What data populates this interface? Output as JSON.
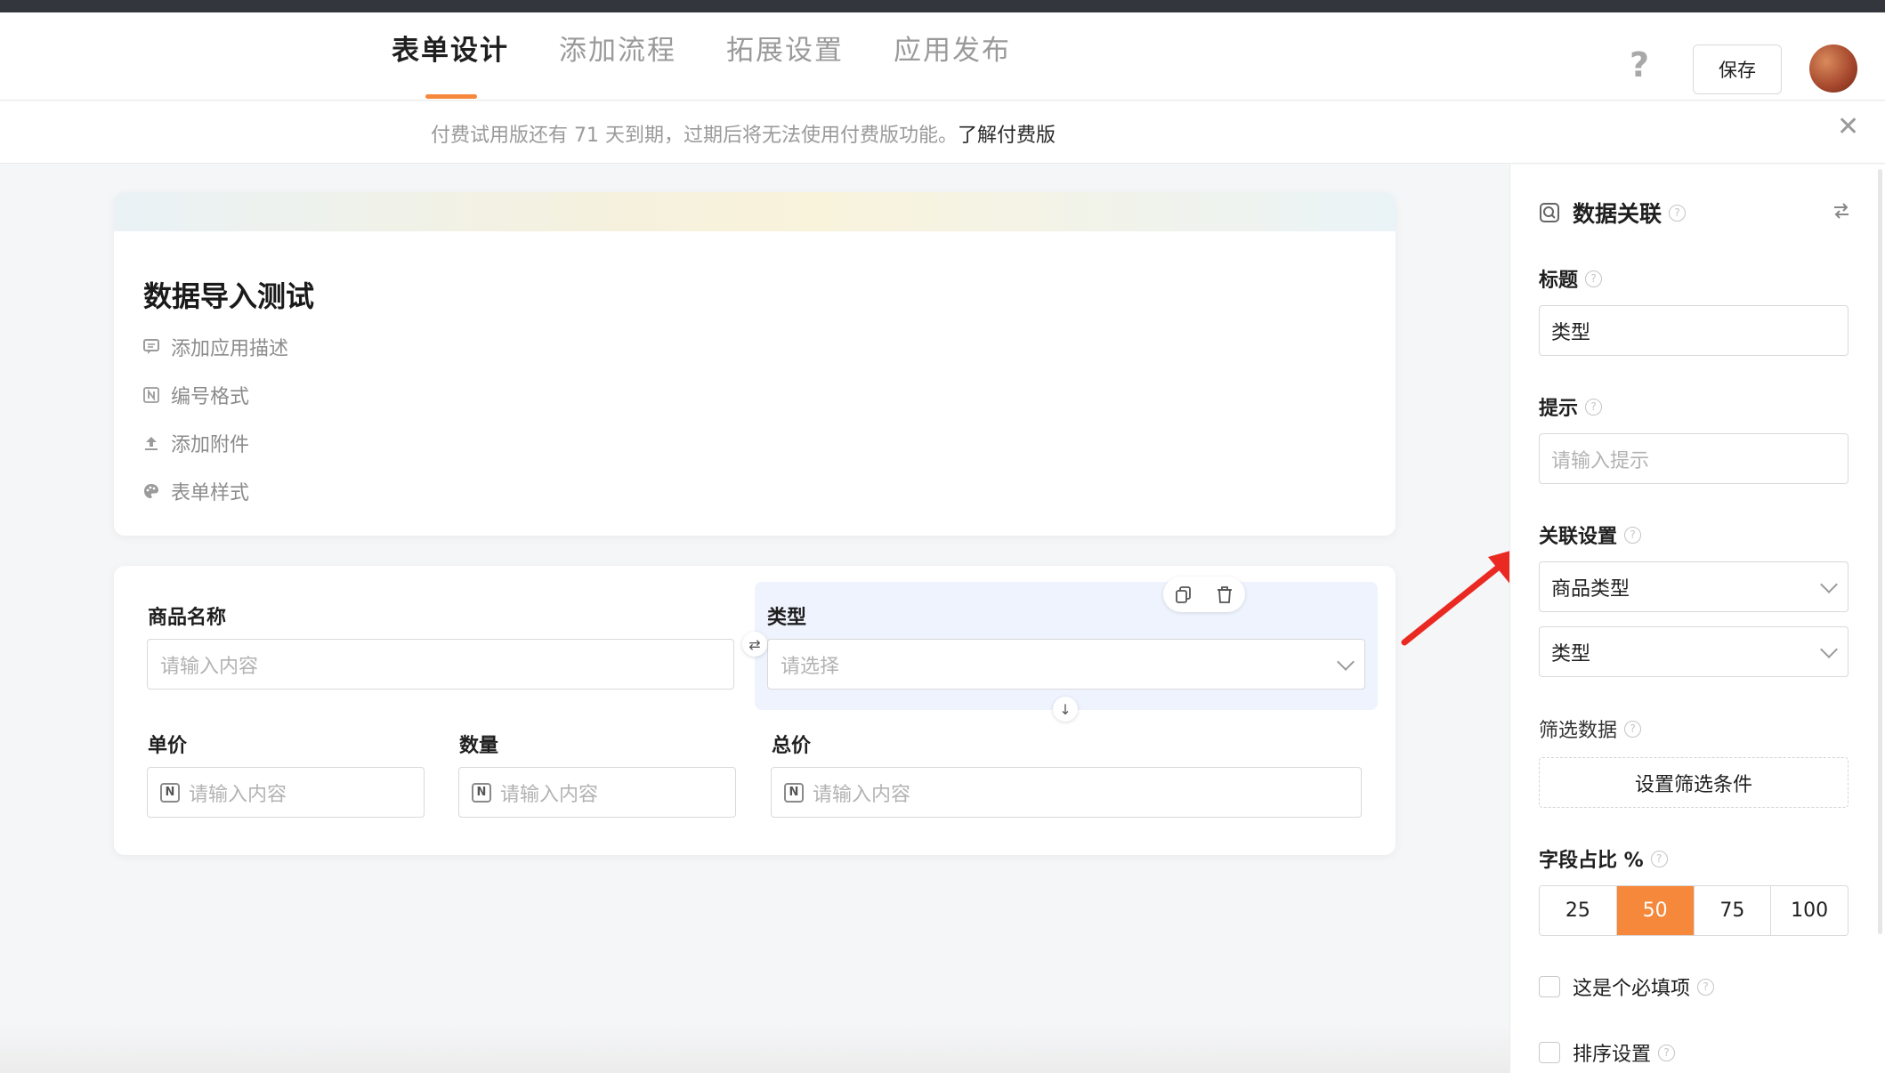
{
  "header": {
    "tabs": [
      {
        "label": "表单设计",
        "active": true
      },
      {
        "label": "添加流程",
        "active": false
      },
      {
        "label": "拓展设置",
        "active": false
      },
      {
        "label": "应用发布",
        "active": false
      }
    ],
    "help_icon": "?",
    "save_label": "保存",
    "accent_color": "#f5883a"
  },
  "notice": {
    "text": "付费试用版还有 71 天到期，过期后将无法使用付费版功能。",
    "link": "了解付费版",
    "close": "✕"
  },
  "form_header": {
    "title": "数据导入测试",
    "actions": [
      {
        "label": "添加应用描述",
        "icon": "comment-icon"
      },
      {
        "label": "编号格式",
        "icon": "number-format-icon"
      },
      {
        "label": "添加附件",
        "icon": "upload-icon"
      },
      {
        "label": "表单样式",
        "icon": "palette-icon"
      }
    ]
  },
  "form_fields": {
    "product_name": {
      "label": "商品名称",
      "placeholder": "请输入内容"
    },
    "type": {
      "label": "类型",
      "placeholder": "请选择"
    },
    "unit_price": {
      "label": "单价",
      "placeholder": "请输入内容"
    },
    "quantity": {
      "label": "数量",
      "placeholder": "请输入内容"
    },
    "total_price": {
      "label": "总价",
      "placeholder": "请输入内容"
    },
    "number_icon_glyph": "N"
  },
  "sidebar": {
    "title": "数据关联",
    "title_field": {
      "label": "标题",
      "value": "类型"
    },
    "hint_field": {
      "label": "提示",
      "placeholder": "请输入提示"
    },
    "link_settings": {
      "label": "关联设置",
      "select1": "商品类型",
      "select2": "类型"
    },
    "filter": {
      "label": "筛选数据",
      "button": "设置筛选条件"
    },
    "width_ratio": {
      "label": "字段占比 %",
      "options": [
        "25",
        "50",
        "75",
        "100"
      ],
      "selected": "50"
    },
    "required": {
      "label": "这是个必填项"
    },
    "sorting": {
      "label": "排序设置"
    }
  }
}
